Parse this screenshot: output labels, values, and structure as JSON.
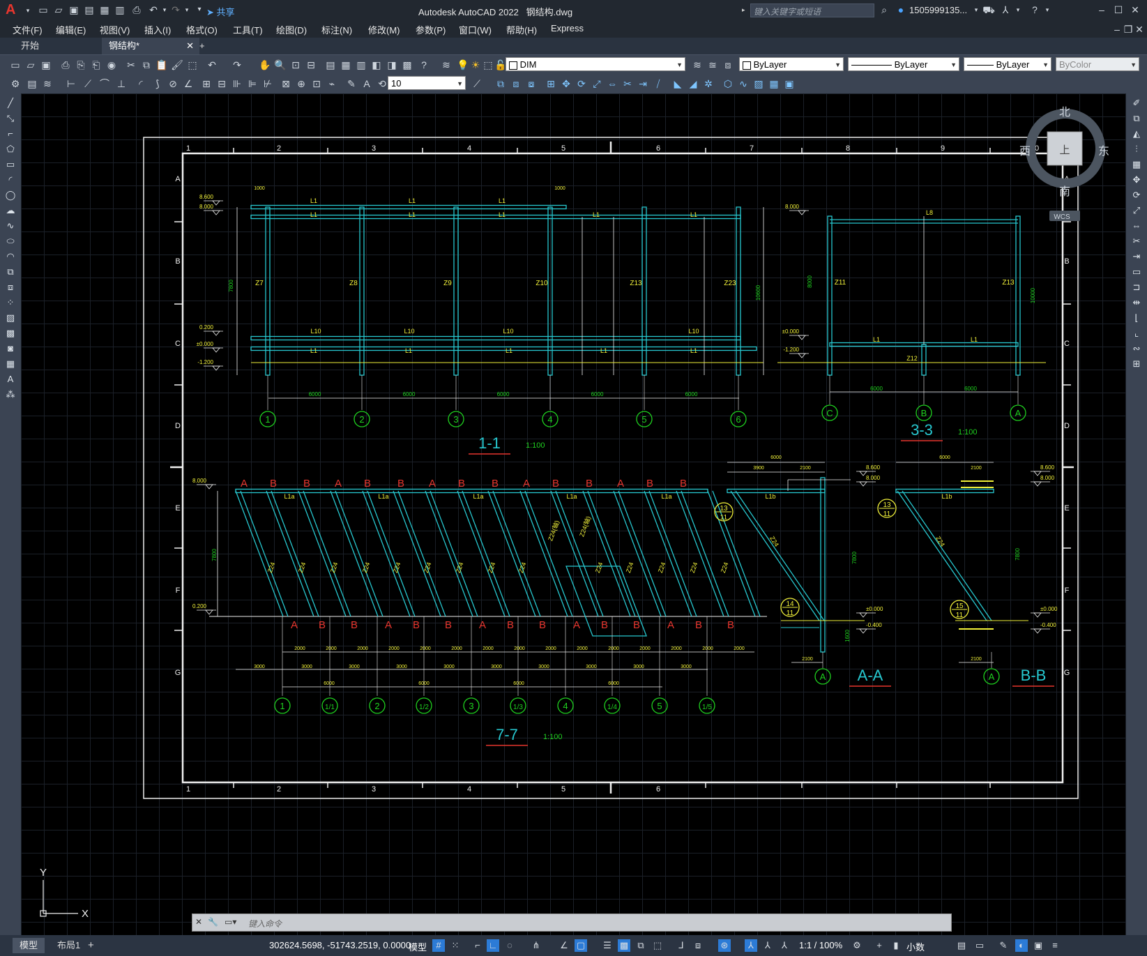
{
  "app": {
    "title": "Autodesk AutoCAD 2022",
    "file": "钢结构.dwg",
    "search_placeholder": "键入关键字或短语",
    "user": "1505999135...",
    "share": "共享"
  },
  "menu": [
    "文件(F)",
    "编辑(E)",
    "视图(V)",
    "插入(I)",
    "格式(O)",
    "工具(T)",
    "绘图(D)",
    "标注(N)",
    "修改(M)",
    "参数(P)",
    "窗口(W)",
    "帮助(H)",
    "Express"
  ],
  "tabs": {
    "start": "开始",
    "doc": "钢结构*",
    "add": "+"
  },
  "toolbar": {
    "layer": "DIM",
    "color": "ByLayer",
    "linetype": "ByLayer",
    "lineweight": "ByLayer",
    "plotstyle": "ByColor",
    "dimscale": "10"
  },
  "viewcube": {
    "north": "北",
    "south": "南",
    "east": "东",
    "west": "西",
    "face": "上",
    "wcs": "WCS"
  },
  "ucs": {
    "y": "Y",
    "x": "X"
  },
  "command": {
    "placeholder": "键入命令"
  },
  "status": {
    "model_tab": "模型",
    "layout_tab": "布局1",
    "add": "+",
    "coords": "302624.5698, -51743.2519, 0.0000",
    "space": "模型",
    "scale": "1:1 / 100%",
    "units": "小数"
  },
  "drawing": {
    "frame_cols_top": [
      "1",
      "2",
      "3",
      "4",
      "5",
      "6",
      "7",
      "8",
      "9",
      "10"
    ],
    "frame_cols_bottom": [
      "1",
      "2",
      "3",
      "4",
      "5",
      "6"
    ],
    "frame_rows": [
      "A",
      "B",
      "C",
      "D",
      "E",
      "F",
      "G"
    ],
    "sec11": {
      "title": "1-1",
      "scale": "1:100",
      "columns": [
        "Z7",
        "Z8",
        "Z9",
        "Z10",
        "Z13",
        "Z23"
      ],
      "axes": [
        "1",
        "2",
        "3",
        "4",
        "5",
        "6"
      ],
      "span": "6000",
      "beam_top": "L1",
      "beam_mid": "L10",
      "levels": [
        "8.600",
        "8.000",
        "0.200",
        "±0.000",
        "-1.200"
      ],
      "dims": [
        "1000",
        "1000",
        "7800",
        "10600"
      ]
    },
    "sec33": {
      "title": "3-3",
      "scale": "1:100",
      "columns": [
        "Z11",
        "Z13"
      ],
      "axes": [
        "C",
        "B",
        "A"
      ],
      "beam_top": "L8",
      "beam_low": "L1",
      "post": "Z12",
      "levels": [
        "8.000",
        "±0.000",
        "-1.200"
      ],
      "span": "6000",
      "dims": [
        "8000",
        "10000"
      ]
    },
    "sec77": {
      "title": "7-7",
      "scale": "1:100",
      "axes": [
        "1",
        "1/1",
        "2",
        "1/2",
        "3",
        "1/3",
        "4",
        "1/4",
        "5",
        "1/5"
      ],
      "brace": "Z24",
      "brace_alt": "Z24(轴)",
      "beam": "L1a",
      "marks_a": "A",
      "marks_b": "B",
      "levels": [
        "8.000",
        "0.200"
      ],
      "dims": [
        "2000",
        "3000",
        "6000",
        "7800"
      ]
    },
    "secAA": {
      "title": "A-A",
      "axis": "A",
      "beam": "L1b",
      "brace": "Z24",
      "callout_top": [
        "13",
        "11"
      ],
      "callout_bot": [
        "14",
        "11"
      ],
      "levels": [
        "8.600",
        "8.000",
        "±0.000",
        "-0.400"
      ],
      "dims": [
        "6000",
        "3900",
        "2100",
        "7800",
        "1600"
      ]
    },
    "secBB": {
      "title": "B-B",
      "axis": "A",
      "beam": "L1b",
      "brace": "Z24",
      "callout_top": [
        "13",
        "11"
      ],
      "callout_bot": [
        "15",
        "11"
      ],
      "levels": [
        "8.600",
        "8.000",
        "±0.000",
        "-0.400"
      ],
      "dims": [
        "6000",
        "2100",
        "7800"
      ]
    }
  },
  "colors": {
    "cyan": "#27c8d0",
    "yellow": "#f2f23a",
    "green": "#1fd21f",
    "red": "#e8362e",
    "white": "#f0f0f0",
    "background": "#000000"
  }
}
